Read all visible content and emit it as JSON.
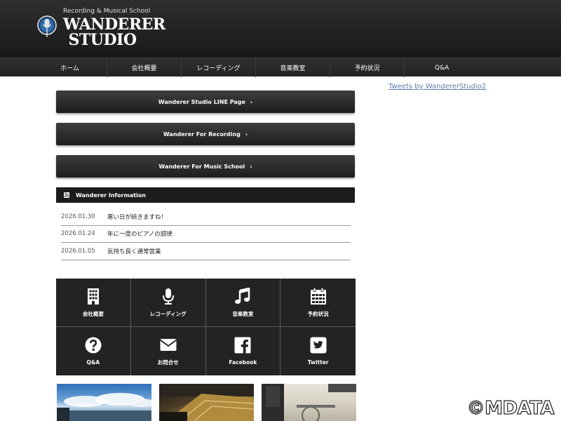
{
  "header": {
    "subtitle": "Recording & Musical School",
    "title_line1": "WANDERER",
    "title_line2": "STUDIO"
  },
  "nav": {
    "items": [
      {
        "label": "ホーム"
      },
      {
        "label": "会社概要"
      },
      {
        "label": "レコーディング"
      },
      {
        "label": "音楽教室"
      },
      {
        "label": "予約状況"
      },
      {
        "label": "Q&A"
      }
    ]
  },
  "sidebar": {
    "tweets_link": "Tweets by WandererStudio2"
  },
  "buttons": [
    {
      "label": "Wanderer Studio LINE Page",
      "chevron": "›"
    },
    {
      "label": "Wanderer For Recording",
      "chevron": "›"
    },
    {
      "label": "Wanderer For Music School",
      "chevron": "›"
    }
  ],
  "info": {
    "heading": "Wanderer Information",
    "icon": "rss-icon",
    "items": [
      {
        "date": "2026.01.30",
        "title": "寒い日が続きますね！"
      },
      {
        "date": "2026.01.24",
        "title": "年に一度のピアノの調律"
      },
      {
        "date": "2026.01.05",
        "title": "気持ち良く通常営業"
      }
    ]
  },
  "grid": {
    "items": [
      {
        "label": "会社概要",
        "icon": "building-icon"
      },
      {
        "label": "レコーディング",
        "icon": "microphone-icon"
      },
      {
        "label": "音楽教室",
        "icon": "music-note-icon"
      },
      {
        "label": "予約状況",
        "icon": "calendar-icon"
      },
      {
        "label": "Q&A",
        "icon": "question-icon"
      },
      {
        "label": "お問合せ",
        "icon": "envelope-icon"
      },
      {
        "label": "Facebook",
        "icon": "facebook-icon"
      },
      {
        "label": "Twitter",
        "icon": "twitter-icon"
      }
    ]
  },
  "watermark": "©MDATA"
}
